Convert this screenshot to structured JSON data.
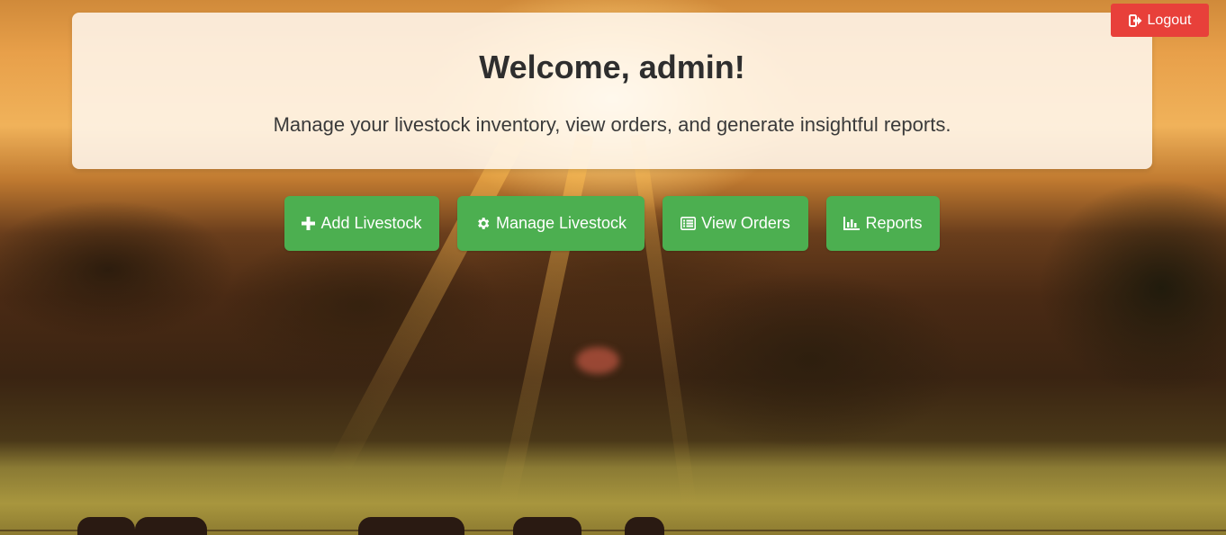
{
  "header": {
    "welcome_title": "Welcome, admin!",
    "welcome_subtitle": "Manage your livestock inventory, view orders, and generate insightful reports."
  },
  "logout": {
    "label": "Logout",
    "icon": "sign-out-icon",
    "color": "#e8403a"
  },
  "actions": [
    {
      "label": "Add Livestock",
      "icon": "plus-icon"
    },
    {
      "label": "Manage Livestock",
      "icon": "gear-icon"
    },
    {
      "label": "View Orders",
      "icon": "list-icon"
    },
    {
      "label": "Reports",
      "icon": "bar-chart-icon"
    }
  ],
  "colors": {
    "action_button": "#4caf50",
    "card_background": "#fff8f0",
    "title_text": "#2e2e2e"
  }
}
